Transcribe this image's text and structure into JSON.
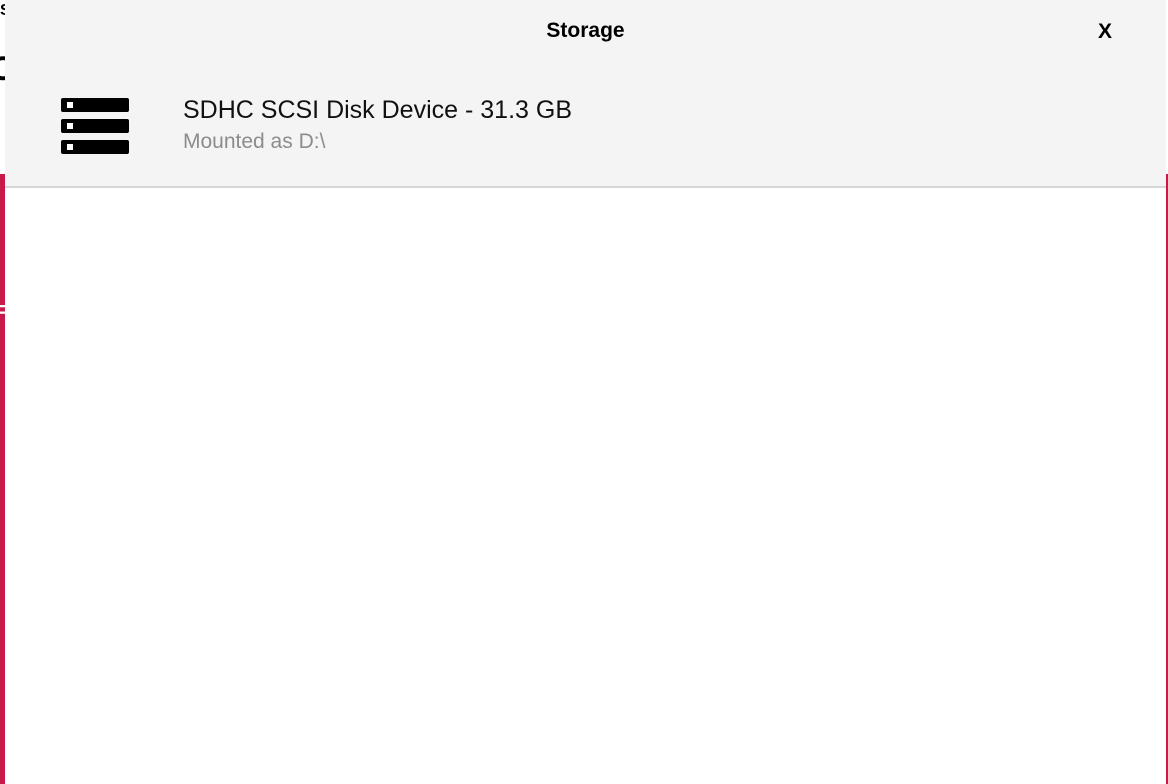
{
  "background": {
    "accent_color": "#c51a4a",
    "glyph_top": "S",
    "glyph_mid": "C",
    "glyph_low": "F"
  },
  "dialog": {
    "title": "Storage",
    "close_label": "X",
    "header_color": "#f4f4f4"
  },
  "storage": {
    "items": [
      {
        "name": "SDHC SCSI Disk Device - 31.3 GB",
        "mount": "Mounted as D:\\",
        "icon": "storage-drive-icon"
      }
    ]
  }
}
